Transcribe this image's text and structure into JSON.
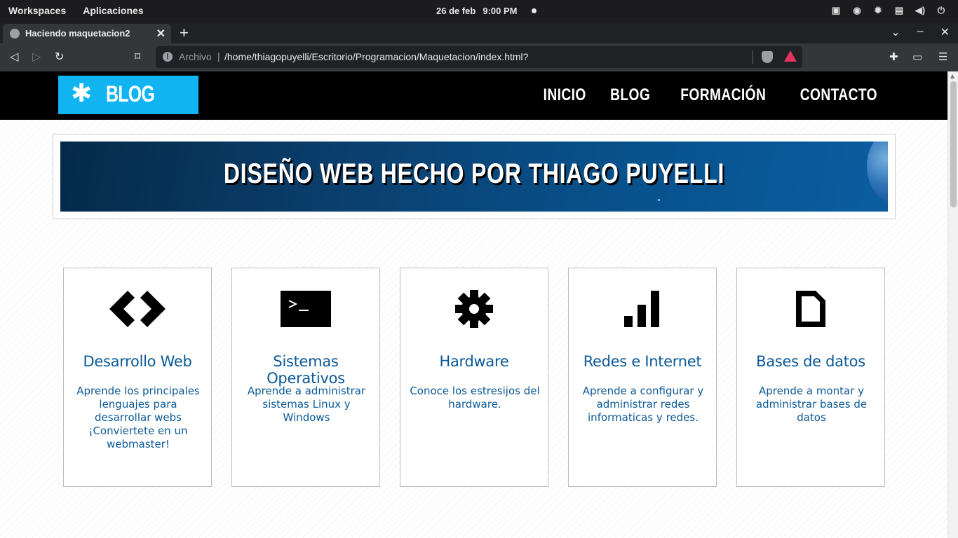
{
  "os_bar": {
    "workspaces": "Workspaces",
    "applications": "Aplicaciones",
    "date": "26 de feb",
    "time": "9:00 PM"
  },
  "browser": {
    "tab_title": "Haciendo maquetacion2",
    "url_scheme": "Archivo",
    "url_separator": "|",
    "url": "/home/thiagopuyelli/Escritorio/Programacion/Maquetacion/index.html?"
  },
  "site": {
    "logo_text": "BLOG",
    "nav": [
      {
        "label": "INICIO"
      },
      {
        "label": "BLOG"
      },
      {
        "label": "FORMACIÓN"
      },
      {
        "label": "CONTACTO"
      }
    ],
    "banner_title": "DISEÑO WEB HECHO POR THIAGO PUYELLI",
    "cards": [
      {
        "icon": "code-icon",
        "title": "Desarrollo Web",
        "text": "Aprende los principales lenguajes para desarrollar webs ¡Conviertete en un webmaster!"
      },
      {
        "icon": "terminal-icon",
        "title": "Sistemas Operativos",
        "text": "Aprende a administrar sistemas Linux y Windows"
      },
      {
        "icon": "gear-icon",
        "title": "Hardware",
        "text": "Conoce los estresijos del hardware."
      },
      {
        "icon": "signal-bars-icon",
        "title": "Redes e Internet",
        "text": "Aprende a configurar y administrar redes informaticas y redes."
      },
      {
        "icon": "document-icon",
        "title": "Bases de datos",
        "text": "Aprende a montar y administrar bases de datos"
      }
    ]
  },
  "colors": {
    "logo_bg": "#10b4f0",
    "card_text": "#0b5998",
    "header_bg": "#000000"
  }
}
